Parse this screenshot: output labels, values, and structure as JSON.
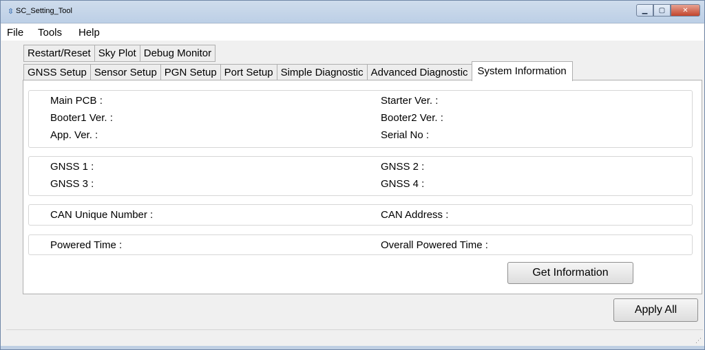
{
  "window": {
    "title": "SC_Setting_Tool",
    "icon": "app-icon",
    "controls": [
      "minimize",
      "maximize",
      "close"
    ]
  },
  "menu": {
    "file": "File",
    "tools": "Tools",
    "help": "Help"
  },
  "tabs_row1": [
    "Restart/Reset",
    "Sky Plot",
    "Debug Monitor"
  ],
  "tabs_row2": [
    "GNSS Setup",
    "Sensor Setup",
    "PGN Setup",
    "Port Setup",
    "Simple Diagnostic",
    "Advanced Diagnostic",
    "System Information"
  ],
  "active_tab": "System Information",
  "groups": {
    "versions": {
      "main_pcb": "Main PCB :",
      "starter_ver": "Starter Ver. :",
      "booter1_ver": "Booter1 Ver. :",
      "booter2_ver": "Booter2 Ver. :",
      "app_ver": "App. Ver. :",
      "serial_no": "Serial No :"
    },
    "gnss": {
      "gnss1": "GNSS 1 :",
      "gnss2": "GNSS 2 :",
      "gnss3": "GNSS 3 :",
      "gnss4": "GNSS 4 :"
    },
    "can": {
      "unique_number": "CAN Unique Number :",
      "address": "CAN Address :"
    },
    "power": {
      "powered_time": "Powered Time :",
      "overall_powered_time": "Overall Powered Time :"
    }
  },
  "buttons": {
    "get_information": "Get Information",
    "apply_all": "Apply All"
  }
}
